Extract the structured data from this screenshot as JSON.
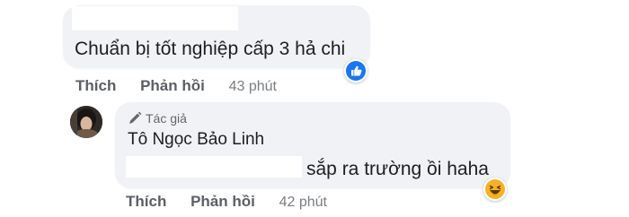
{
  "comments": [
    {
      "text": "Chuẩn bị tốt nghiệp cấp 3 hả chi",
      "actions": {
        "like": "Thích",
        "reply": "Phản hồi",
        "time": "43 phút"
      },
      "reaction": "like-icon"
    },
    {
      "author_badge": "Tác giả",
      "author_name": "Tô Ngọc Bảo Linh",
      "text": "sắp ra trường ồi haha",
      "actions": {
        "like": "Thích",
        "reply": "Phản hồi",
        "time": "42 phút"
      },
      "reaction": "haha-icon"
    }
  ],
  "colors": {
    "bubble": "#f0f2f5",
    "text": "#1c1e21",
    "meta": "#65676b",
    "like_blue": "#1877f2",
    "haha_yellow": "#f7b125"
  }
}
